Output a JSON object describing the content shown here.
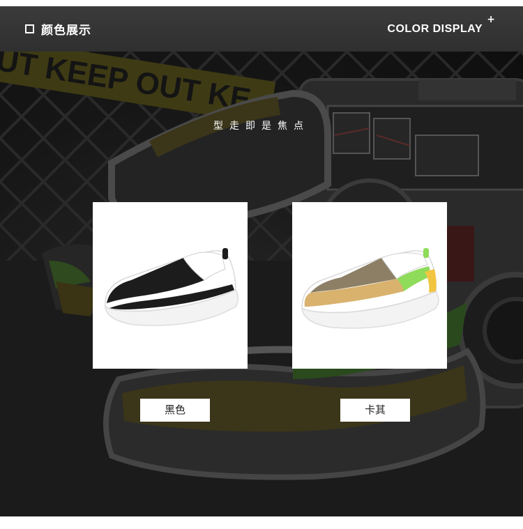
{
  "header": {
    "title": "颜色展示",
    "right_title": "COLOR DISPLAY",
    "plus": "+"
  },
  "scene": {
    "tape_text": "UT KEEP OUT KE",
    "tagline": "型走即是焦点"
  },
  "products": [
    {
      "label": "黑色",
      "upper_color": "#1c1c1c",
      "accent_color": "#1c1c1c",
      "heel_color": "#ffffff"
    },
    {
      "label": "卡其",
      "upper_color": "#8c7f66",
      "accent_color": "#d9b26e",
      "heel_color": "#f2c541",
      "collar_color": "#8fdb5a"
    }
  ]
}
